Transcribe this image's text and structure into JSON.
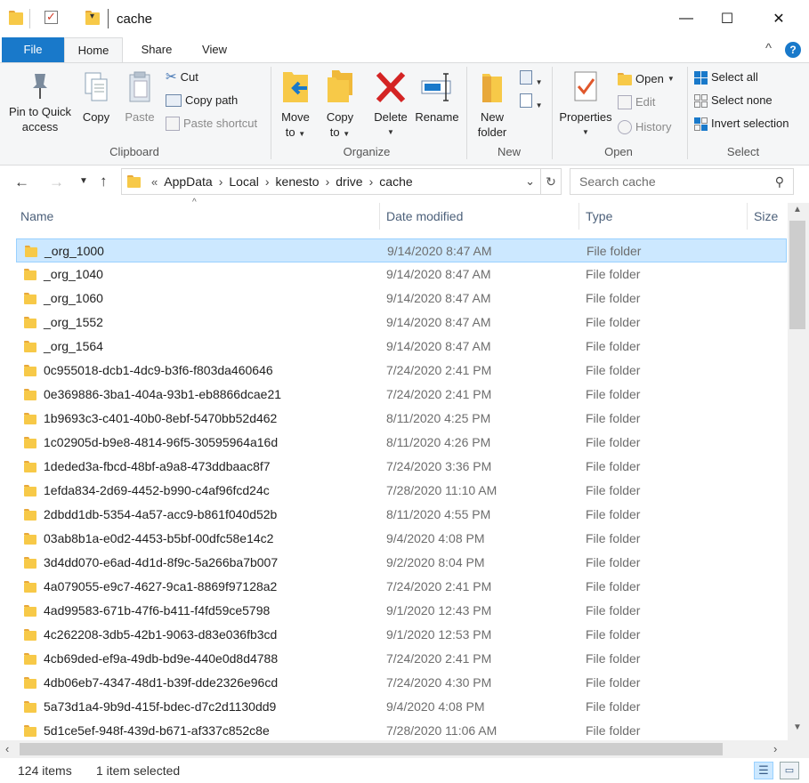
{
  "window": {
    "title": "cache",
    "minimize_glyph": "—",
    "maximize_glyph": "☐",
    "close_glyph": "✕"
  },
  "ribbon_tabs": {
    "file": "File",
    "home": "Home",
    "share": "Share",
    "view": "View",
    "collapse_glyph": "^",
    "help_glyph": "?"
  },
  "clipboard": {
    "label": "Clipboard",
    "pin_line1": "Pin to Quick",
    "pin_line2": "access",
    "copy": "Copy",
    "paste": "Paste",
    "cut": "Cut",
    "copy_path": "Copy path",
    "paste_shortcut": "Paste shortcut"
  },
  "organize": {
    "label": "Organize",
    "move_line1": "Move",
    "move_line2": "to",
    "copy_line1": "Copy",
    "copy_line2": "to",
    "delete": "Delete",
    "rename": "Rename"
  },
  "new_group": {
    "label": "New",
    "new_line1": "New",
    "new_line2": "folder"
  },
  "open_group": {
    "label": "Open",
    "properties": "Properties",
    "open": "Open",
    "edit": "Edit",
    "history": "History"
  },
  "select_group": {
    "label": "Select",
    "select_all": "Select all",
    "select_none": "Select none",
    "invert": "Invert selection"
  },
  "address": {
    "overflow": "«",
    "crumbs": [
      "AppData",
      "Local",
      "kenesto",
      "drive",
      "cache"
    ],
    "search_placeholder": "Search cache"
  },
  "columns": {
    "name": "Name",
    "date": "Date modified",
    "type": "Type",
    "size": "Size"
  },
  "rows": [
    {
      "name": "_org_1000",
      "date": "9/14/2020 8:47 AM",
      "type": "File folder",
      "selected": true
    },
    {
      "name": "_org_1040",
      "date": "9/14/2020 8:47 AM",
      "type": "File folder"
    },
    {
      "name": "_org_1060",
      "date": "9/14/2020 8:47 AM",
      "type": "File folder"
    },
    {
      "name": "_org_1552",
      "date": "9/14/2020 8:47 AM",
      "type": "File folder"
    },
    {
      "name": "_org_1564",
      "date": "9/14/2020 8:47 AM",
      "type": "File folder"
    },
    {
      "name": "0c955018-dcb1-4dc9-b3f6-f803da460646",
      "date": "7/24/2020 2:41 PM",
      "type": "File folder"
    },
    {
      "name": "0e369886-3ba1-404a-93b1-eb8866dcae21",
      "date": "7/24/2020 2:41 PM",
      "type": "File folder"
    },
    {
      "name": "1b9693c3-c401-40b0-8ebf-5470bb52d462",
      "date": "8/11/2020 4:25 PM",
      "type": "File folder"
    },
    {
      "name": "1c02905d-b9e8-4814-96f5-30595964a16d",
      "date": "8/11/2020 4:26 PM",
      "type": "File folder"
    },
    {
      "name": "1deded3a-fbcd-48bf-a9a8-473ddbaac8f7",
      "date": "7/24/2020 3:36 PM",
      "type": "File folder"
    },
    {
      "name": "1efda834-2d69-4452-b990-c4af96fcd24c",
      "date": "7/28/2020 11:10 AM",
      "type": "File folder"
    },
    {
      "name": "2dbdd1db-5354-4a57-acc9-b861f040d52b",
      "date": "8/11/2020 4:55 PM",
      "type": "File folder"
    },
    {
      "name": "03ab8b1a-e0d2-4453-b5bf-00dfc58e14c2",
      "date": "9/4/2020 4:08 PM",
      "type": "File folder"
    },
    {
      "name": "3d4dd070-e6ad-4d1d-8f9c-5a266ba7b007",
      "date": "9/2/2020 8:04 PM",
      "type": "File folder"
    },
    {
      "name": "4a079055-e9c7-4627-9ca1-8869f97128a2",
      "date": "7/24/2020 2:41 PM",
      "type": "File folder"
    },
    {
      "name": "4ad99583-671b-47f6-b411-f4fd59ce5798",
      "date": "9/1/2020 12:43 PM",
      "type": "File folder"
    },
    {
      "name": "4c262208-3db5-42b1-9063-d83e036fb3cd",
      "date": "9/1/2020 12:53 PM",
      "type": "File folder"
    },
    {
      "name": "4cb69ded-ef9a-49db-bd9e-440e0d8d4788",
      "date": "7/24/2020 2:41 PM",
      "type": "File folder"
    },
    {
      "name": "4db06eb7-4347-48d1-b39f-dde2326e96cd",
      "date": "7/24/2020 4:30 PM",
      "type": "File folder"
    },
    {
      "name": "5a73d1a4-9b9d-415f-bdec-d7c2d1130dd9",
      "date": "9/4/2020 4:08 PM",
      "type": "File folder"
    },
    {
      "name": "5d1ce5ef-948f-439d-b671-af337c852c8e",
      "date": "7/28/2020 11:06 AM",
      "type": "File folder"
    }
  ],
  "status": {
    "count": "124 items",
    "selected": "1 item selected"
  },
  "colors": {
    "accent": "#1979ca",
    "selection": "#cce8ff",
    "folder": "#f7c948"
  }
}
